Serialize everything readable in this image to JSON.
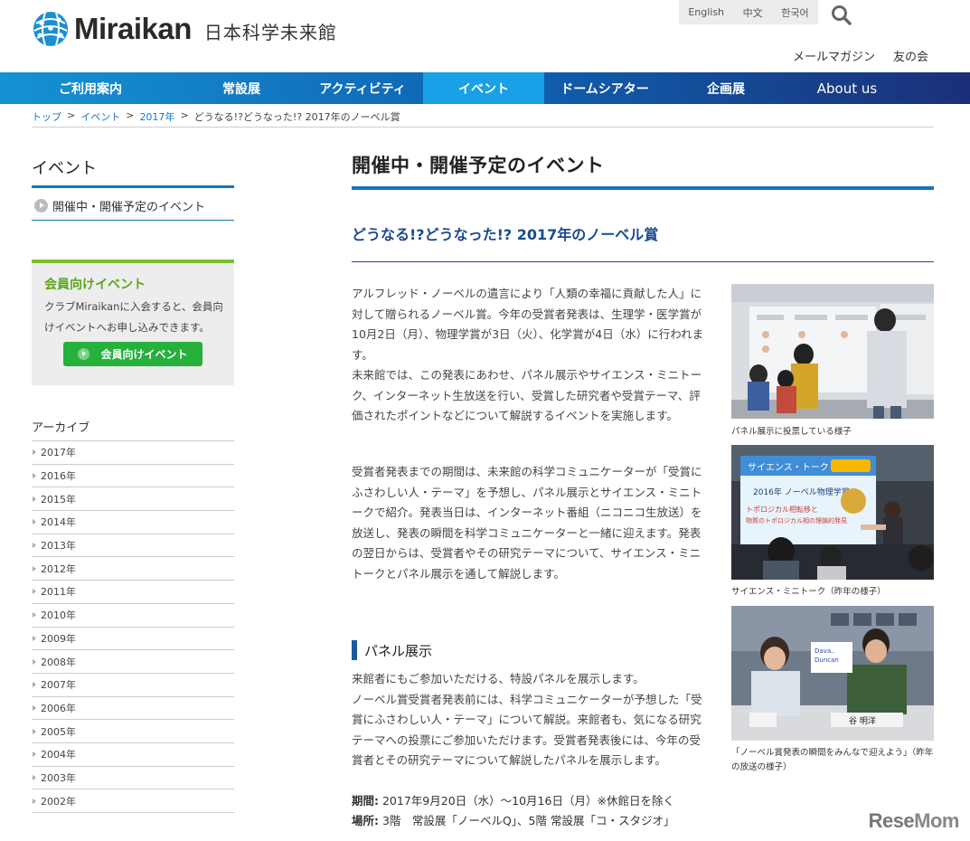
{
  "header": {
    "logo_word": "Miraikan",
    "logo_ja": "日本科学未来館",
    "languages": [
      "English",
      "中文",
      "한국어"
    ],
    "util_links": [
      "メールマガジン",
      "友の会"
    ]
  },
  "gnav": [
    "ご利用案内",
    "常設展",
    "アクティビティ",
    "イベント",
    "ドームシアター",
    "企画展",
    "About us"
  ],
  "breadcrumb": {
    "items": [
      "トップ",
      "イベント",
      "2017年"
    ],
    "current": "どうなる!?どうなった!? 2017年のノーベル賞",
    "sep": ">"
  },
  "sidebar": {
    "title": "イベント",
    "link": "開催中・開催予定のイベント",
    "member": {
      "title": "会員向けイベント",
      "desc": "クラブMiraikanに入会すると、会員向けイベントへお申し込みできます。",
      "button": "会員向けイベント"
    },
    "archive_title": "アーカイブ",
    "archive": [
      "2017年",
      "2016年",
      "2015年",
      "2014年",
      "2013年",
      "2012年",
      "2011年",
      "2010年",
      "2009年",
      "2008年",
      "2007年",
      "2006年",
      "2005年",
      "2004年",
      "2003年",
      "2002年"
    ]
  },
  "main": {
    "title": "開催中・開催予定のイベント",
    "event_title": "どうなる!?どうなった!? 2017年のノーベル賞",
    "p1": "アルフレッド・ノーベルの遺言により「人類の幸福に貢献した人」に対して贈られるノーベル賞。今年の受賞者発表は、生理学・医学賞が10月2日（月）、物理学賞が3日（火）、化学賞が4日（水）に行われます。\n未来館では、この発表にあわせ、パネル展示やサイエンス・ミニトーク、インターネット生放送を行い、受賞した研究者や受賞テーマ、評価されたポイントなどについて解説するイベントを実施します。",
    "p2": "受賞者発表までの期間は、未来館の科学コミュニケーターが「受賞にふさわしい人・テーマ」を予想し、パネル展示とサイエンス・ミニトークで紹介。発表当日は、インターネット番組（ニコニコ生放送）を放送し、発表の瞬間を科学コミュニケーターと一緒に迎えます。発表の翌日からは、受賞者やその研究テーマについて、サイエンス・ミニトークとパネル展示を通して解説します。",
    "section_title": "パネル展示",
    "p3": "来館者にもご参加いただける、特設パネルを展示します。\nノーベル賞受賞者発表前には、科学コミュニケーターが予想した「受賞にふさわしい人・テーマ」について解説。来館者も、気になる研究テーマへの投票にご参加いただけます。受賞者発表後には、今年の受賞者とその研究テーマについて解説したパネルを展示します。",
    "period_label": "期間:",
    "period_value": "2017年9月20日（水）～10月16日（月）※休館日を除く",
    "place_label": "場所:",
    "place_value": "3階　常設展「ノーベルQ」、5階 常設展「コ・スタジオ」"
  },
  "photos": {
    "cap1": "パネル展示に投票している様子",
    "cap2": "サイエンス・ミニトーク（昨年の様子）",
    "cap3": "「ノーベル賞発表の瞬間をみんなで迎えよう」（昨年の放送の様子）",
    "slide_heading": "サイエンス・トーク",
    "slide_sub": "2016年 ノーベル物理学賞",
    "slide_line1": "トポロジカル相転移と",
    "slide_line2": "物質のトポロジカル相の理論的発見",
    "table_name": "谷 明洋"
  },
  "watermark": {
    "a": "Rese",
    "b": "Mom"
  },
  "colors": {
    "nav_start": "#1592d4",
    "nav_end": "#1b2f78",
    "accent": "#1576b8",
    "member_green": "#26b03c"
  }
}
